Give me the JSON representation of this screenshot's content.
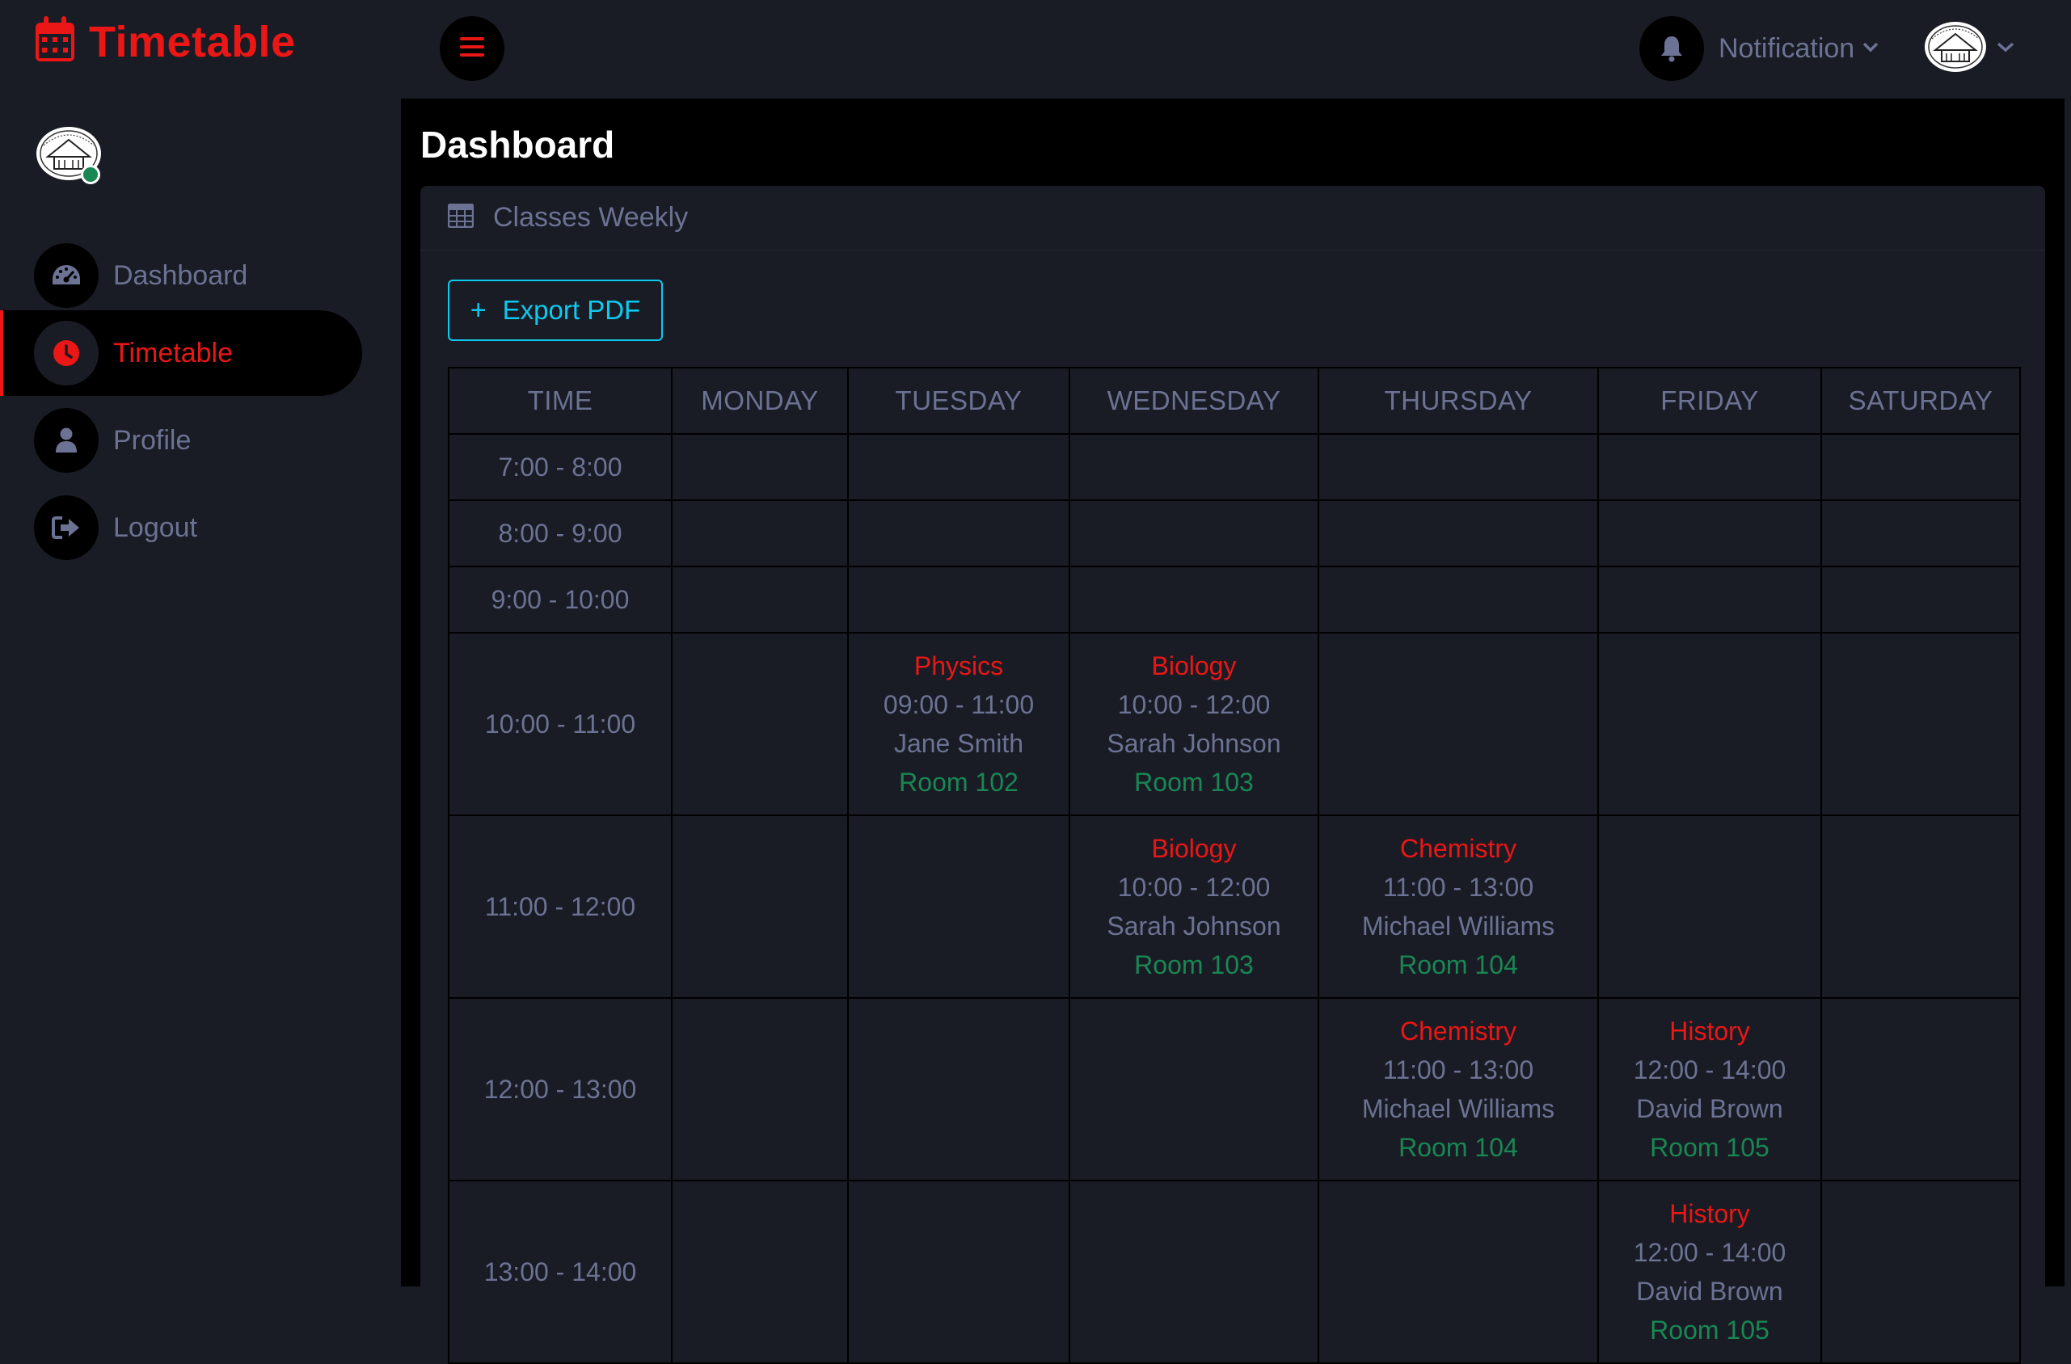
{
  "brand": {
    "title": "Timetable"
  },
  "header": {
    "notification_label": "Notification"
  },
  "sidebar": {
    "items": [
      {
        "label": "Dashboard",
        "icon": "gauge-icon",
        "active": false
      },
      {
        "label": "Timetable",
        "icon": "clock-icon",
        "active": true
      },
      {
        "label": "Profile",
        "icon": "user-icon",
        "active": false
      },
      {
        "label": "Logout",
        "icon": "sign-out-icon",
        "active": false
      }
    ]
  },
  "main": {
    "title": "Dashboard",
    "panel_title": "Classes Weekly",
    "export_label": "Export PDF"
  },
  "timetable": {
    "headers": [
      "TIME",
      "MONDAY",
      "TUESDAY",
      "WEDNESDAY",
      "THURSDAY",
      "FRIDAY",
      "SATURDAY"
    ],
    "rows": [
      {
        "time": "7:00 - 8:00",
        "cells": [
          null,
          null,
          null,
          null,
          null,
          null
        ]
      },
      {
        "time": "8:00 - 9:00",
        "cells": [
          null,
          null,
          null,
          null,
          null,
          null
        ]
      },
      {
        "time": "9:00 - 10:00",
        "cells": [
          null,
          null,
          null,
          null,
          null,
          null
        ]
      },
      {
        "time": "10:00 - 11:00",
        "cells": [
          null,
          {
            "subject": "Physics",
            "hours": "09:00 - 11:00",
            "teacher": "Jane Smith",
            "room": "Room 102"
          },
          {
            "subject": "Biology",
            "hours": "10:00 - 12:00",
            "teacher": "Sarah Johnson",
            "room": "Room 103"
          },
          null,
          null,
          null
        ]
      },
      {
        "time": "11:00 - 12:00",
        "cells": [
          null,
          null,
          {
            "subject": "Biology",
            "hours": "10:00 - 12:00",
            "teacher": "Sarah Johnson",
            "room": "Room 103"
          },
          {
            "subject": "Chemistry",
            "hours": "11:00 - 13:00",
            "teacher": "Michael Williams",
            "room": "Room 104"
          },
          null,
          null
        ]
      },
      {
        "time": "12:00 - 13:00",
        "cells": [
          null,
          null,
          null,
          {
            "subject": "Chemistry",
            "hours": "11:00 - 13:00",
            "teacher": "Michael Williams",
            "room": "Room 104"
          },
          {
            "subject": "History",
            "hours": "12:00 - 14:00",
            "teacher": "David Brown",
            "room": "Room 105"
          },
          null
        ]
      },
      {
        "time": "13:00 - 14:00",
        "cells": [
          null,
          null,
          null,
          null,
          {
            "subject": "History",
            "hours": "12:00 - 14:00",
            "teacher": "David Brown",
            "room": "Room 105"
          },
          null
        ]
      }
    ]
  },
  "colors": {
    "background": "#000000",
    "surface": "#191c24",
    "accent": "#eb1616",
    "muted_text": "#6c7293",
    "room_green": "#198754",
    "button_cyan": "#0dcaf0"
  }
}
